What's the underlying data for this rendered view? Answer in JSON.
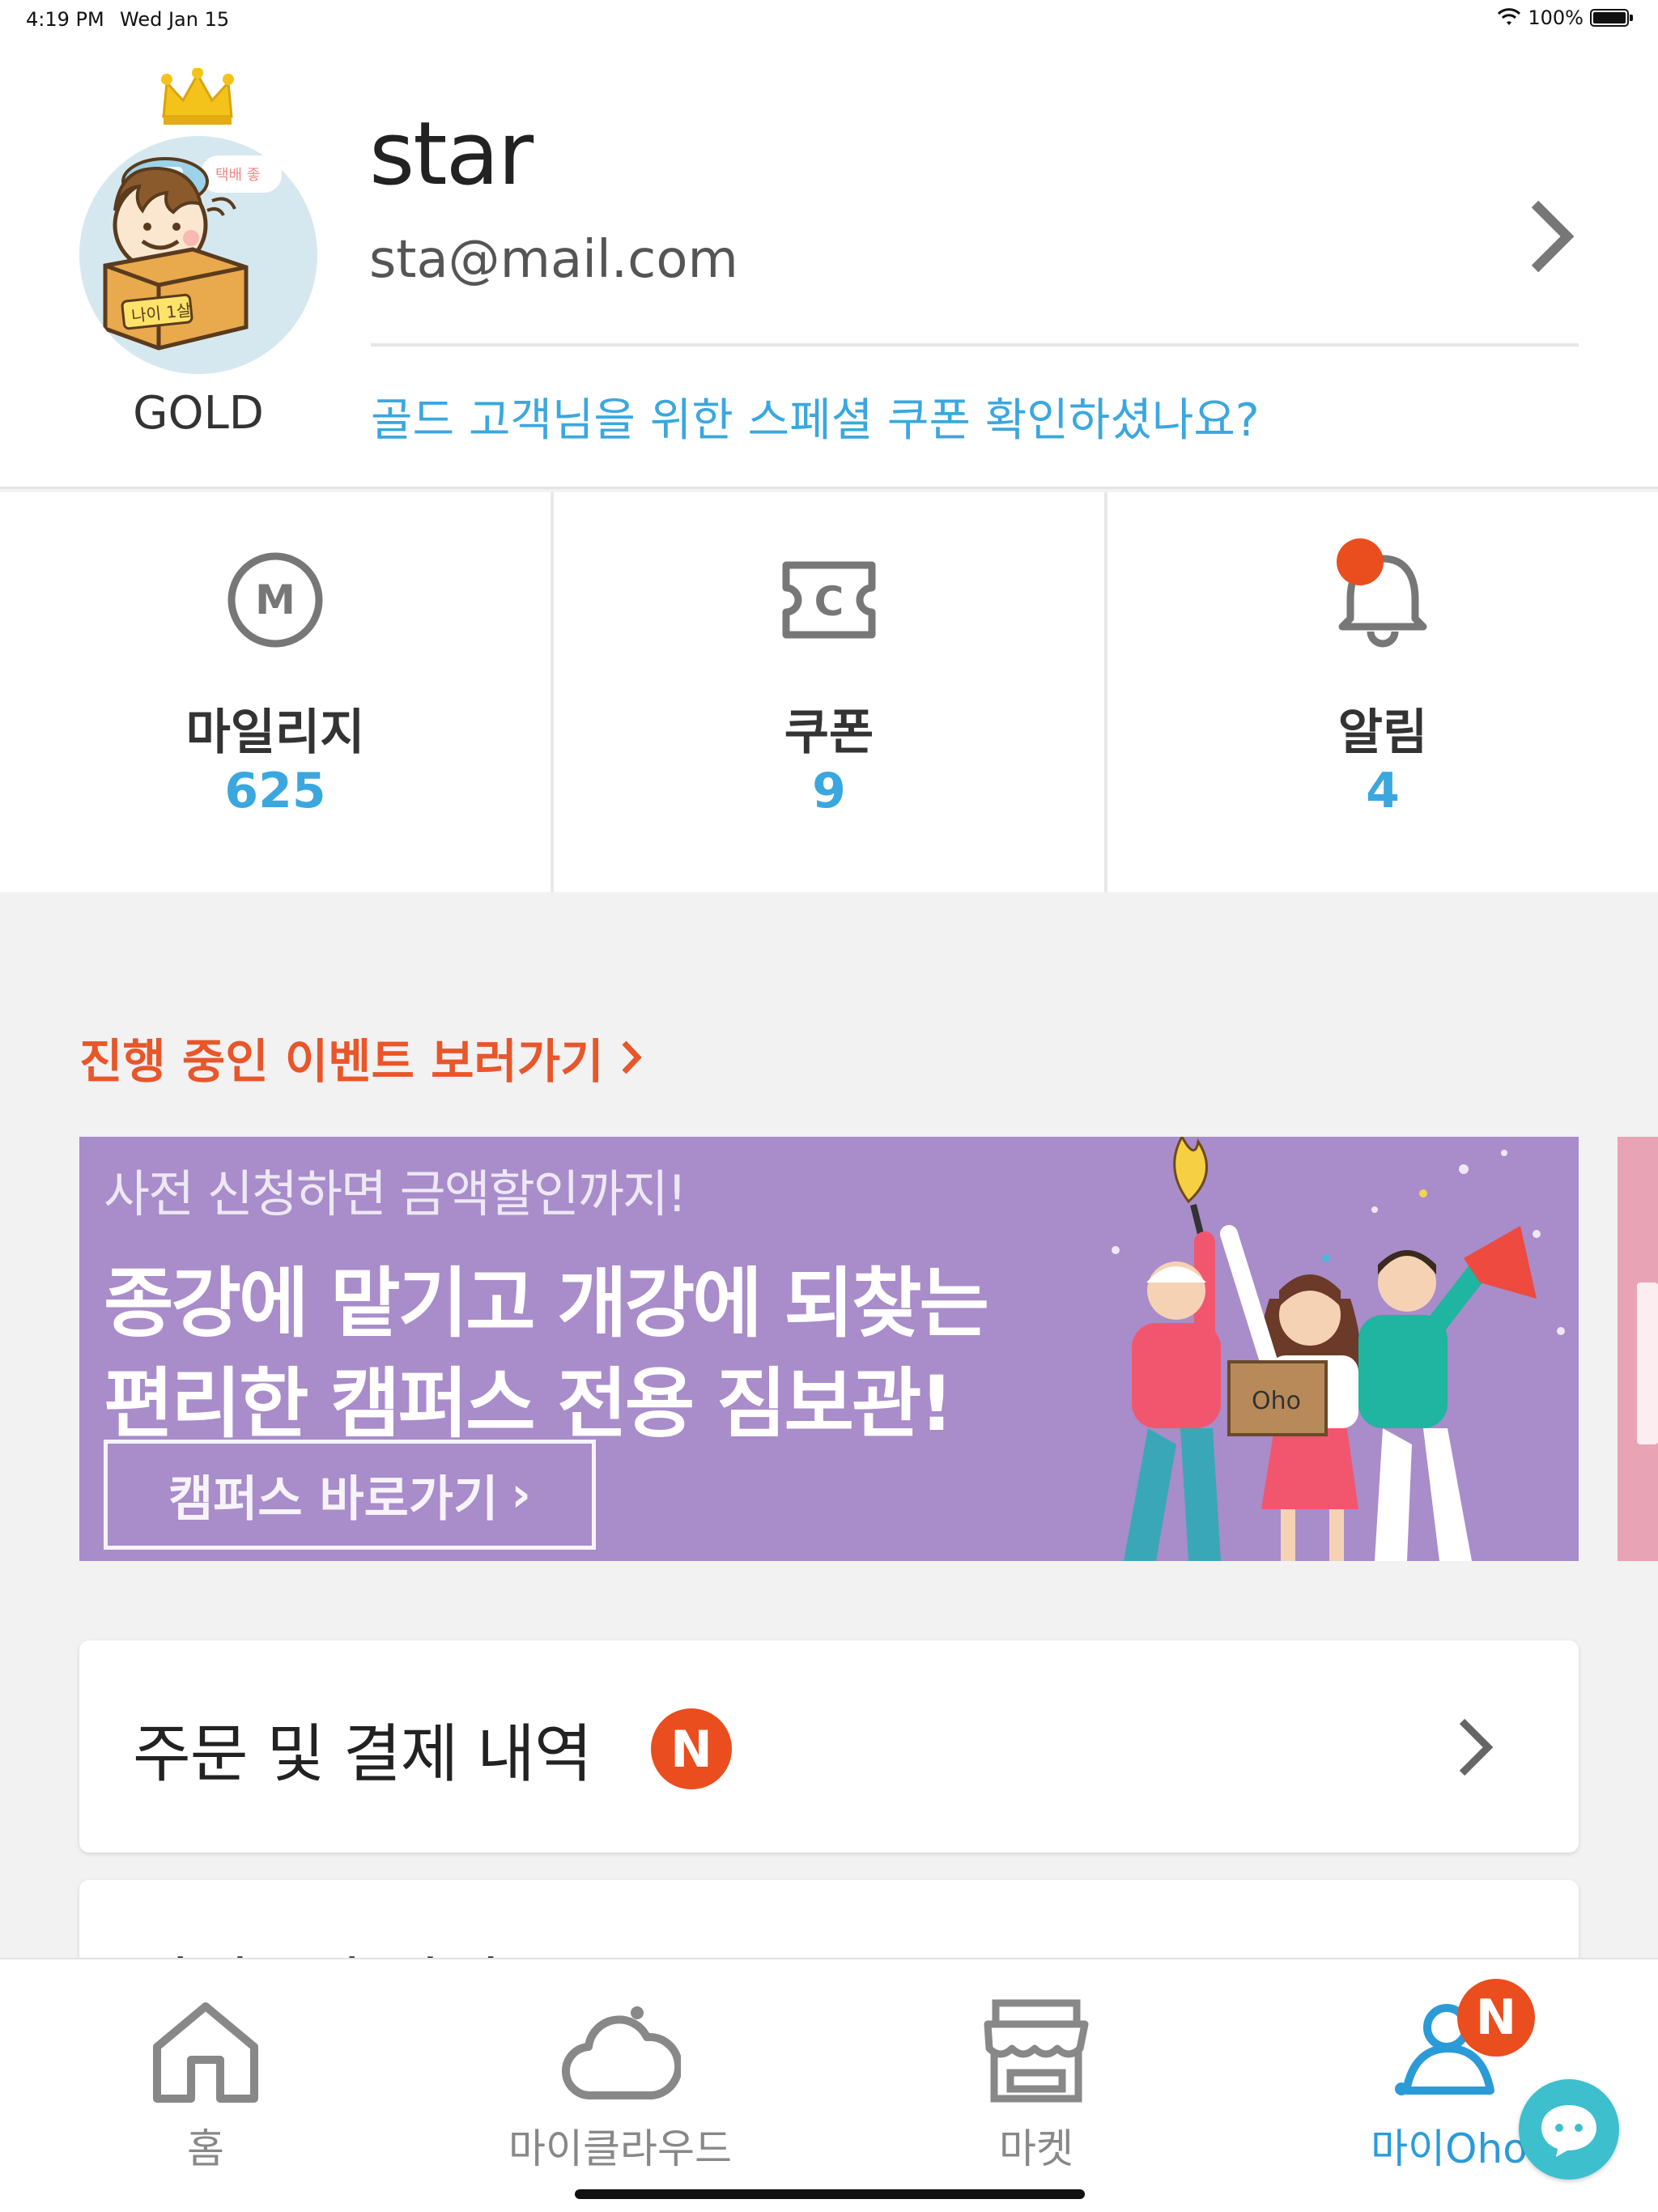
{
  "status_bar": {
    "time": "4:19 PM",
    "date": "Wed Jan 15",
    "battery": "100%"
  },
  "profile": {
    "username": "star",
    "email": "sta@mail.com",
    "grade": "GOLD",
    "avatar_badge": "나이 1살",
    "avatar_bubble": "택배 좋",
    "coupon_message": "골드 고객님을 위한 스페셜 쿠폰 확인하셨나요?"
  },
  "stats": [
    {
      "label": "마일리지",
      "value": "625",
      "icon": "mileage-m-icon"
    },
    {
      "label": "쿠폰",
      "value": "9",
      "icon": "coupon-c-icon"
    },
    {
      "label": "알림",
      "value": "4",
      "icon": "bell-icon"
    }
  ],
  "events": {
    "link_label": "진행 중인 이벤트 보러가기",
    "banner": {
      "subtitle": "사전 신청하면 금액할인까지!",
      "line1": "종강에 맡기고 개강에 되찾는",
      "line2": "편리한 캠퍼스 전용 짐보관!",
      "button_label": "캠퍼스 바로가기",
      "box_label": "Oho"
    }
  },
  "menu": {
    "orders_label": "주문 및 결제 내역",
    "orders_badge": "N",
    "next_label": "결제수단 관리"
  },
  "tabbar": {
    "items": [
      {
        "label": "홈",
        "icon": "home-icon"
      },
      {
        "label": "마이클라우드",
        "icon": "cloud-icon"
      },
      {
        "label": "마켓",
        "icon": "store-icon"
      },
      {
        "label": "마이Oho",
        "icon": "person-icon",
        "badge": "N"
      }
    ]
  },
  "colors": {
    "accent_blue": "#3ba7df",
    "accent_orange": "#e8562a",
    "badge_red": "#ea4d1e",
    "banner_purple": "#a98cca"
  }
}
